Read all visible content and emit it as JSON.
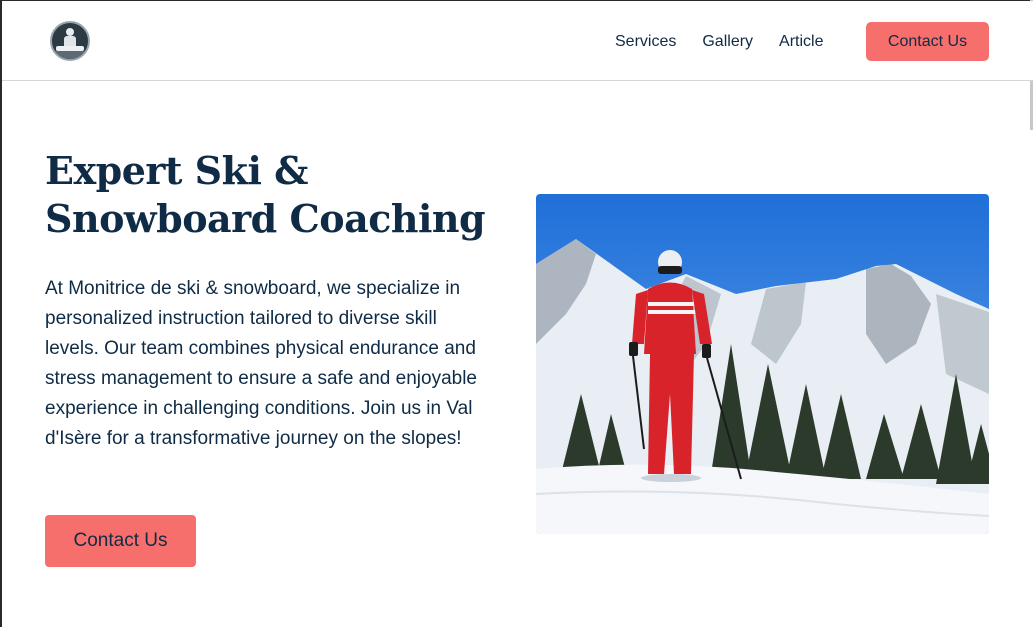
{
  "nav": {
    "items": [
      {
        "label": "Services"
      },
      {
        "label": "Gallery"
      },
      {
        "label": "Article"
      }
    ],
    "cta_label": "Contact Us"
  },
  "hero": {
    "title_line1": "Expert Ski &",
    "title_line2": "Snowboard Coaching",
    "description": "At Monitrice de ski & snowboard, we specialize in personalized instruction tailored to diverse skill levels. Our team combines physical endurance and stress management to ensure a safe and enjoyable experience in challenging conditions. Join us in Val d'Isère for a transformative journey on the slopes!",
    "cta_label": "Contact Us",
    "image_alt": "Ski instructor in red suit on snowy slope"
  },
  "colors": {
    "accent": "#f76f6c",
    "text": "#0f2b45"
  }
}
